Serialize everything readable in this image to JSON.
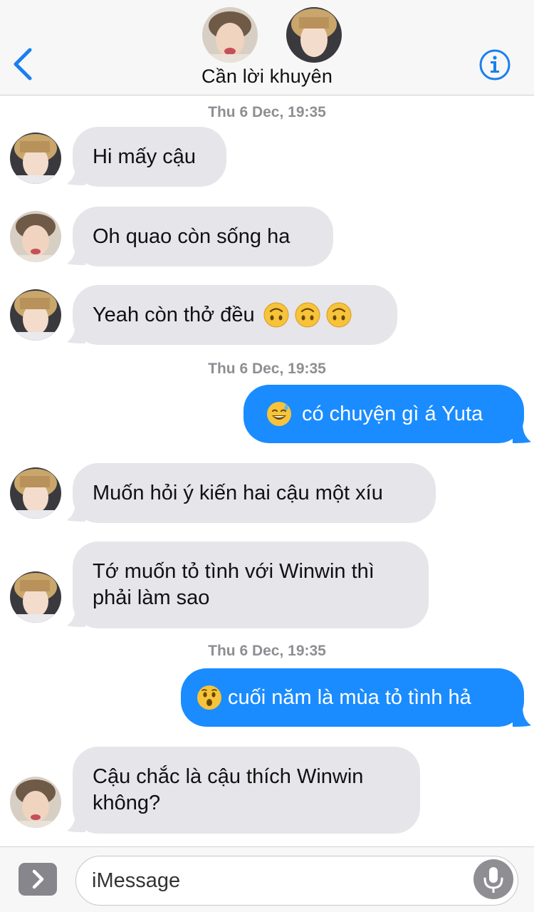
{
  "header": {
    "title": "Cần lời khuyên",
    "back_icon": "chevron-left-icon",
    "info_icon": "info-circle-icon",
    "accent": "#1a7ff0"
  },
  "messages": [
    {
      "type": "timestamp",
      "text": "Thu 6 Dec, 19:35"
    },
    {
      "type": "in",
      "sender": "yuta",
      "text": "Hi mấy cậu"
    },
    {
      "type": "in",
      "sender": "friend",
      "text": "Oh quao còn sống ha"
    },
    {
      "type": "in",
      "sender": "yuta",
      "text": "Yeah còn thở đều",
      "emoji": [
        "upside-down-face-icon",
        "upside-down-face-icon",
        "upside-down-face-icon"
      ]
    },
    {
      "type": "timestamp",
      "text": "Thu 6 Dec, 19:35"
    },
    {
      "type": "out",
      "text": "có chuyện gì á Yuta",
      "emoji": [
        "sweat-smile-icon"
      ]
    },
    {
      "type": "in",
      "sender": "yuta",
      "text": "Muốn hỏi ý kiến hai cậu một xíu"
    },
    {
      "type": "in",
      "sender": "yuta",
      "lines": [
        "Tớ muốn tỏ tình với Winwin thì",
        "phải làm sao"
      ]
    },
    {
      "type": "timestamp",
      "text": "Thu 6 Dec, 19:35"
    },
    {
      "type": "out",
      "text": "cuối năm là mùa tỏ tình hả",
      "emoji": [
        "hushed-face-icon"
      ]
    },
    {
      "type": "in",
      "sender": "friend",
      "lines": [
        "Cậu chắc là cậu thích Winwin",
        "không?"
      ]
    }
  ],
  "composer": {
    "placeholder": "iMessage",
    "apps_icon": "chevron-right-icon",
    "mic_icon": "microphone-icon"
  },
  "colors": {
    "incoming_bubble": "#e5e5ea",
    "outgoing_bubble": "#1a8cff",
    "timestamp": "#8e8e93"
  }
}
